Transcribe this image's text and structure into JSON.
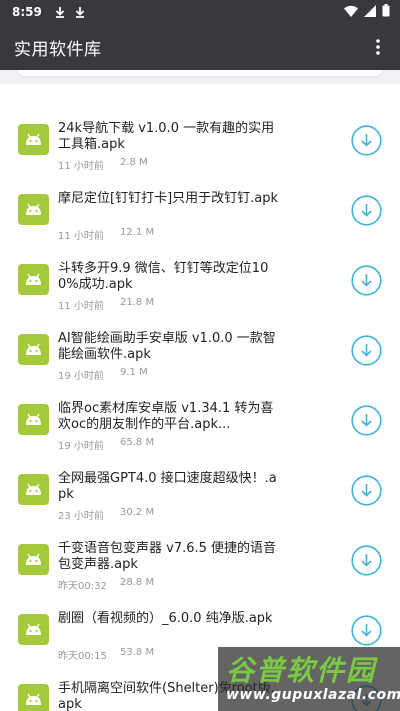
{
  "statusbar": {
    "time": "8:59",
    "icons": [
      "download-icon",
      "download-icon",
      "wifi-icon",
      "signal-icon",
      "battery-icon"
    ]
  },
  "appbar": {
    "title": "实用软件库",
    "menu_icon": "more-vert-icon"
  },
  "colors": {
    "appbar": "#37393f",
    "android_icon": "#a4c93a",
    "download_accent": "#3fb4d9"
  },
  "items": [
    {
      "name": "24k导航下载 v1.0.0 一款有趣的实用工具箱.apk",
      "time": "11 小时前",
      "size": "2.8 M"
    },
    {
      "name": "摩尼定位[钉钉打卡]只用于改钉钉.apk",
      "time": "11 小时前",
      "size": "12.1 M"
    },
    {
      "name": "斗转多开9.9 微信、钉钉等改定位100%成功.apk",
      "time": "11 小时前",
      "size": "21.8 M"
    },
    {
      "name": "AI智能绘画助手安卓版 v1.0.0 一款智能绘画软件.apk",
      "time": "19 小时前",
      "size": "9.1 M"
    },
    {
      "name": "临界oc素材库安卓版 v1.34.1 转为喜欢oc的朋友制作的平台.apk...",
      "time": "19 小时前",
      "size": "65.8 M"
    },
    {
      "name": "全网最强GPT4.0 接口速度超级快！.apk",
      "time": "23 小时前",
      "size": "30.2 M"
    },
    {
      "name": "千变语音包变声器 v7.6.5 便捷的语音包变声器.apk",
      "time": "昨天00:32",
      "size": "28.8 M"
    },
    {
      "name": "剧圈（看视频的）_6.0.0 纯净版.apk",
      "time": "昨天00:15",
      "size": "53.8 M"
    },
    {
      "name": "手机隔离空间软件(Shelter)免root版.apk",
      "time": "",
      "size": ""
    }
  ],
  "watermark": {
    "brand": "谷普软件园",
    "url": "www.gupuxlazal.com"
  }
}
